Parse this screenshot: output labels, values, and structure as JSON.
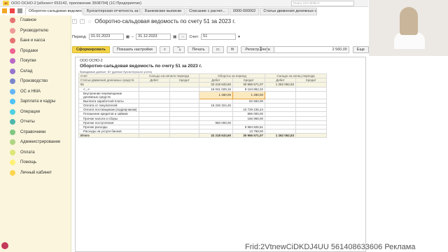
{
  "window": {
    "title": "ООО ОСНО-2 [абонент 653142, приложение 3508794] (1С:Предприятие)",
    "search_placeholder": "Поиск Ctrl+Shift+F"
  },
  "tabs": [
    {
      "label": "Оборотно-сальдовая ведомость"
    },
    {
      "label": "Бухгалтерская отчетность за Ян"
    },
    {
      "label": "Банковские выписки"
    },
    {
      "label": "Списание с расчет..."
    },
    {
      "label": "0000-000002"
    },
    {
      "label": "Статьи движения денежных сре"
    }
  ],
  "sidebar": {
    "items": [
      {
        "label": "Главное",
        "color": "#e57373"
      },
      {
        "label": "Руководителю",
        "color": "#ef9a9a"
      },
      {
        "label": "Банк и касса",
        "color": "#e57373"
      },
      {
        "label": "Продажи",
        "color": "#f06292"
      },
      {
        "label": "Покупки",
        "color": "#ba68c8"
      },
      {
        "label": "Склад",
        "color": "#9575cd"
      },
      {
        "label": "Производство",
        "color": "#7986cb"
      },
      {
        "label": "ОС и НМА",
        "color": "#64b5f6"
      },
      {
        "label": "Зарплата и кадры",
        "color": "#4fc3f7"
      },
      {
        "label": "Операции",
        "color": "#4dd0e1"
      },
      {
        "label": "Отчеты",
        "color": "#4db6ac"
      },
      {
        "label": "Справочники",
        "color": "#81c784"
      },
      {
        "label": "Администрирование",
        "color": "#aed581"
      },
      {
        "label": "Оплата",
        "color": "#dce775"
      },
      {
        "label": "Помощь",
        "color": "#fff176"
      },
      {
        "label": "Личный кабинет",
        "color": "#ffd54f"
      }
    ]
  },
  "doc": {
    "title": "Оборотно-сальдовая ведомость по счету 51 за 2023 г.",
    "period_label": "Период:",
    "date_from": "01.01.2023",
    "date_to": "31.12.2023",
    "account_label": "Счет:",
    "account": "51",
    "form_button": "Сформировать",
    "settings_button": "Показать настройки",
    "print_button": "Печать",
    "register_button": "Регистр учета",
    "sum_value": "2 560,00",
    "more_button": "Еще"
  },
  "report": {
    "org": "ООО ОСНО-2",
    "title": "Оборотно-сальдовая ведомость по счету 51 за 2023 г.",
    "note": "Выводимые данные: БУ (данные бухгалтерского учета)",
    "headers": {
      "account": "Счет",
      "open": "Сальдо на начало периода",
      "turnover": "Обороты за период",
      "close": "Сальдо на конец периода",
      "articles": "Статьи движения денежных средств",
      "debit": "Дебет",
      "credit": "Кредит"
    },
    "rows": [
      {
        "name": "51",
        "d1": "",
        "c1": "",
        "d2": "32 218 633,60",
        "c2": "30 956 571,07",
        "d3": "1 262 062,53",
        "c3": "",
        "type": "acc"
      },
      {
        "name": "<...>",
        "d1": "",
        "c1": "",
        "d2": "16 041 029,15",
        "c2": "9 104 852,32",
        "d3": "",
        "c3": "",
        "type": "row"
      },
      {
        "name": "Внутренние перемещение денежных средств",
        "d1": "",
        "c1": "",
        "d2": "1 280,00",
        "c2": "1 280,00",
        "d3": "",
        "c3": "",
        "type": "row2"
      },
      {
        "name": "Выплата заработной платы",
        "d1": "",
        "c1": "",
        "d2": "",
        "c2": "82 650,00",
        "d3": "",
        "c3": "",
        "type": "row"
      },
      {
        "name": "Оплата от покупателей",
        "d1": "",
        "c1": "",
        "d2": "15 226 324,45",
        "c2": "",
        "d3": "",
        "c3": "",
        "type": "row"
      },
      {
        "name": "Оплата поставщикам (подрядчикам)",
        "d1": "",
        "c1": "",
        "d2": "",
        "c2": "10 729 235,24",
        "d3": "",
        "c3": "",
        "type": "row2"
      },
      {
        "name": "Погашение кредитов и займов",
        "d1": "",
        "c1": "",
        "d2": "",
        "c2": "865 000,00",
        "d3": "",
        "c3": "",
        "type": "row"
      },
      {
        "name": "Прочие налоги и сборы",
        "d1": "",
        "c1": "",
        "d2": "",
        "c2": "165 969,00",
        "d3": "",
        "c3": "",
        "type": "row"
      },
      {
        "name": "Прочие поступления",
        "d1": "",
        "c1": "",
        "d2": "950 000,00",
        "c2": "",
        "d3": "",
        "c3": "",
        "type": "row"
      },
      {
        "name": "Прочие расходы",
        "d1": "",
        "c1": "",
        "d2": "",
        "c2": "9 984 826,51",
        "d3": "",
        "c3": "",
        "type": "row"
      },
      {
        "name": "Расходы на услуги банков",
        "d1": "",
        "c1": "",
        "d2": "",
        "c2": "13 758,00",
        "d3": "",
        "c3": "",
        "type": "row"
      },
      {
        "name": "Итого",
        "d1": "",
        "c1": "",
        "d2": "32 218 633,60",
        "c2": "30 956 571,07",
        "d3": "1 262 062,53",
        "c3": "",
        "type": "total"
      }
    ]
  },
  "overlay": {
    "text": "Frid:2VtnewCiDKDJ4UU 561408633606 Реклама"
  }
}
